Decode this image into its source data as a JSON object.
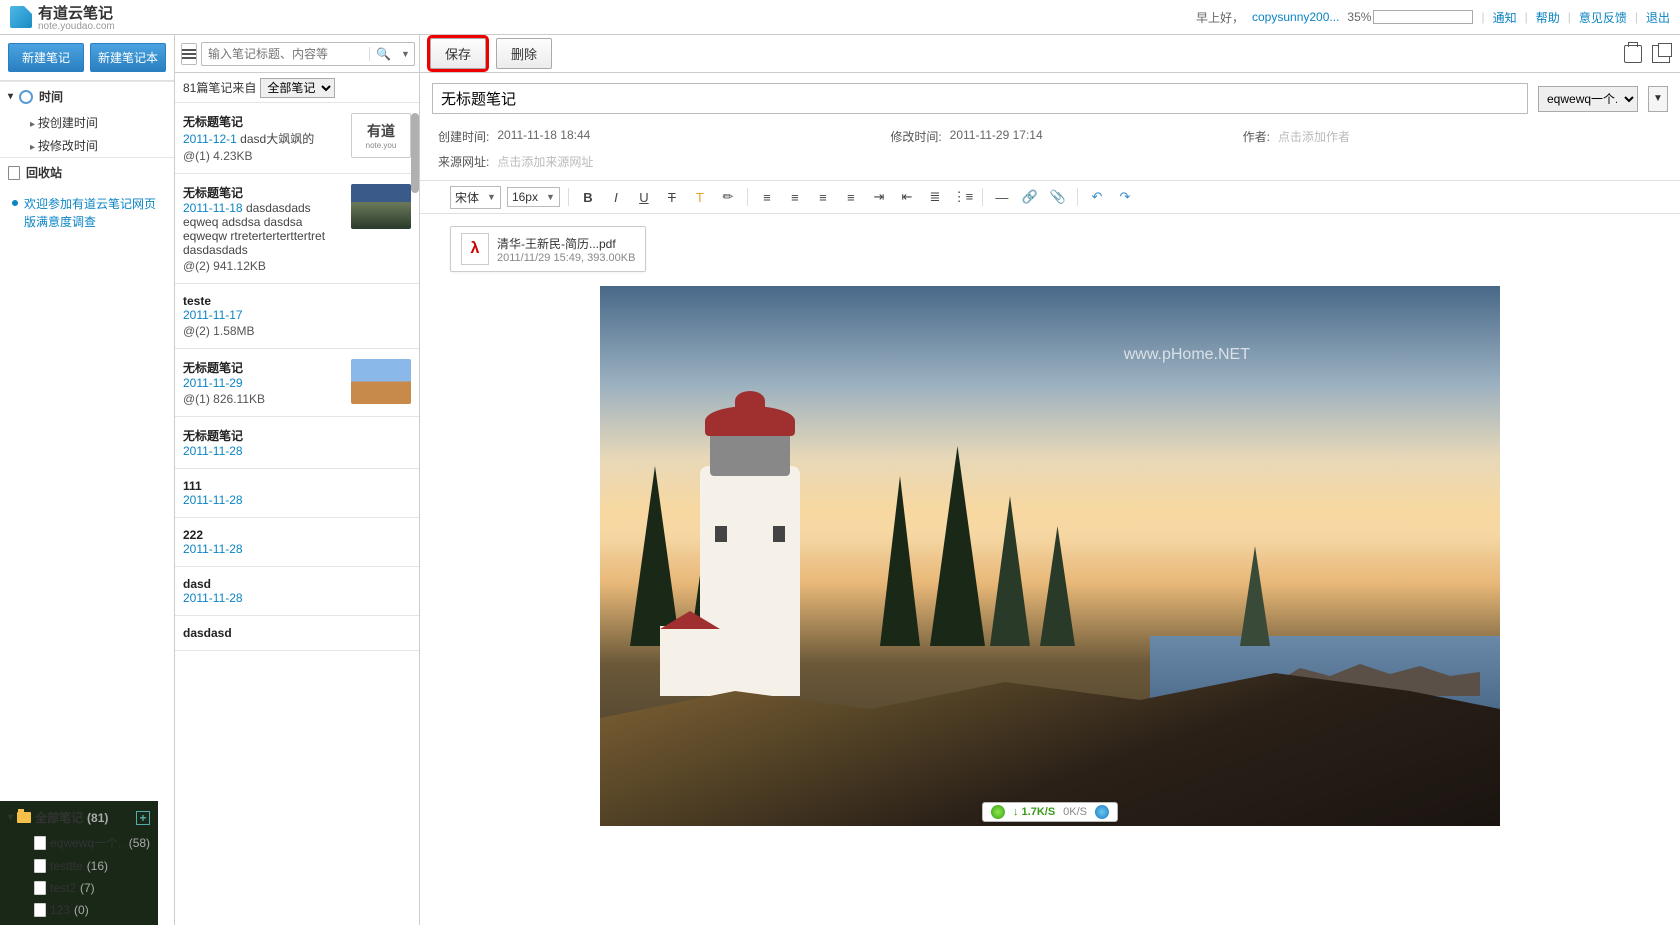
{
  "header": {
    "brand_title": "有道云笔记",
    "brand_url": "note.youdao.com",
    "greeting": "早上好，",
    "username": "copysunny200...",
    "progress_pct": "35%",
    "progress_width": 35,
    "links": {
      "notify": "通知",
      "help": "帮助",
      "feedback": "意见反馈",
      "logout": "退出"
    }
  },
  "sidebar": {
    "new_note": "新建笔记",
    "new_notebook": "新建笔记本",
    "all_notes": "全部笔记",
    "all_notes_count": "(81)",
    "notebooks": [
      {
        "name": "eqwewq一个..",
        "count": "(58)"
      },
      {
        "name": "testtte",
        "count": "(16)"
      },
      {
        "name": "test2",
        "count": "(7)"
      },
      {
        "name": "123",
        "count": "(0)"
      }
    ],
    "time_section": "时间",
    "by_created": "按创建时间",
    "by_modified": "按修改时间",
    "recycle": "回收站",
    "survey": "欢迎参加有道云笔记网页版满意度调查"
  },
  "notelist": {
    "search_placeholder": "输入笔记标题、内容等",
    "count_prefix": "81篇笔记来自",
    "filter_option": "全部笔记",
    "items": [
      {
        "title": "无标题笔记",
        "date": "2011-12-1",
        "snippet": "dasd大飒飒的",
        "meta": "@(1) 4.23KB",
        "thumb": "text"
      },
      {
        "title": "无标题笔记",
        "date": "2011-11-18",
        "snippet": "dasdasdads eqweq adsdsa dasdsa eqweqw rtreterterterttertret dasdasdads",
        "meta": "@(2) 941.12KB",
        "thumb": "lh"
      },
      {
        "title": "teste",
        "date": "2011-11-17",
        "snippet": "",
        "meta": "@(2) 1.58MB",
        "thumb": ""
      },
      {
        "title": "无标题笔记",
        "date": "2011-11-29",
        "snippet": "",
        "meta": "@(1) 826.11KB",
        "thumb": "desert"
      },
      {
        "title": "无标题笔记",
        "date": "2011-11-28",
        "snippet": "",
        "meta": "",
        "thumb": ""
      },
      {
        "title": "111",
        "date": "2011-11-28",
        "snippet": "",
        "meta": "",
        "thumb": ""
      },
      {
        "title": "222",
        "date": "2011-11-28",
        "snippet": "",
        "meta": "",
        "thumb": ""
      },
      {
        "title": "dasd",
        "date": "2011-11-28",
        "snippet": "",
        "meta": "",
        "thumb": ""
      },
      {
        "title": "dasdasd",
        "date": "",
        "snippet": "",
        "meta": "",
        "thumb": ""
      }
    ]
  },
  "editor": {
    "save": "保存",
    "delete": "删除",
    "title_value": "无标题笔记",
    "notebook_selected": "eqwewq一个...",
    "created_lbl": "创建时间:",
    "created_val": "2011-11-18 18:44",
    "modified_lbl": "修改时间:",
    "modified_val": "2011-11-29 17:14",
    "author_lbl": "作者:",
    "author_ph": "点击添加作者",
    "source_lbl": "来源网址:",
    "source_ph": "点击添加来源网址",
    "font_family": "宋体",
    "font_size": "16px",
    "attachment": {
      "name": "清华-王新民-简历...pdf",
      "detail": "2011/11/29 15:49, 393.00KB"
    },
    "watermark": "www.pHome.NET"
  },
  "status": {
    "down": "1.7K/S",
    "up": "0K/S"
  }
}
